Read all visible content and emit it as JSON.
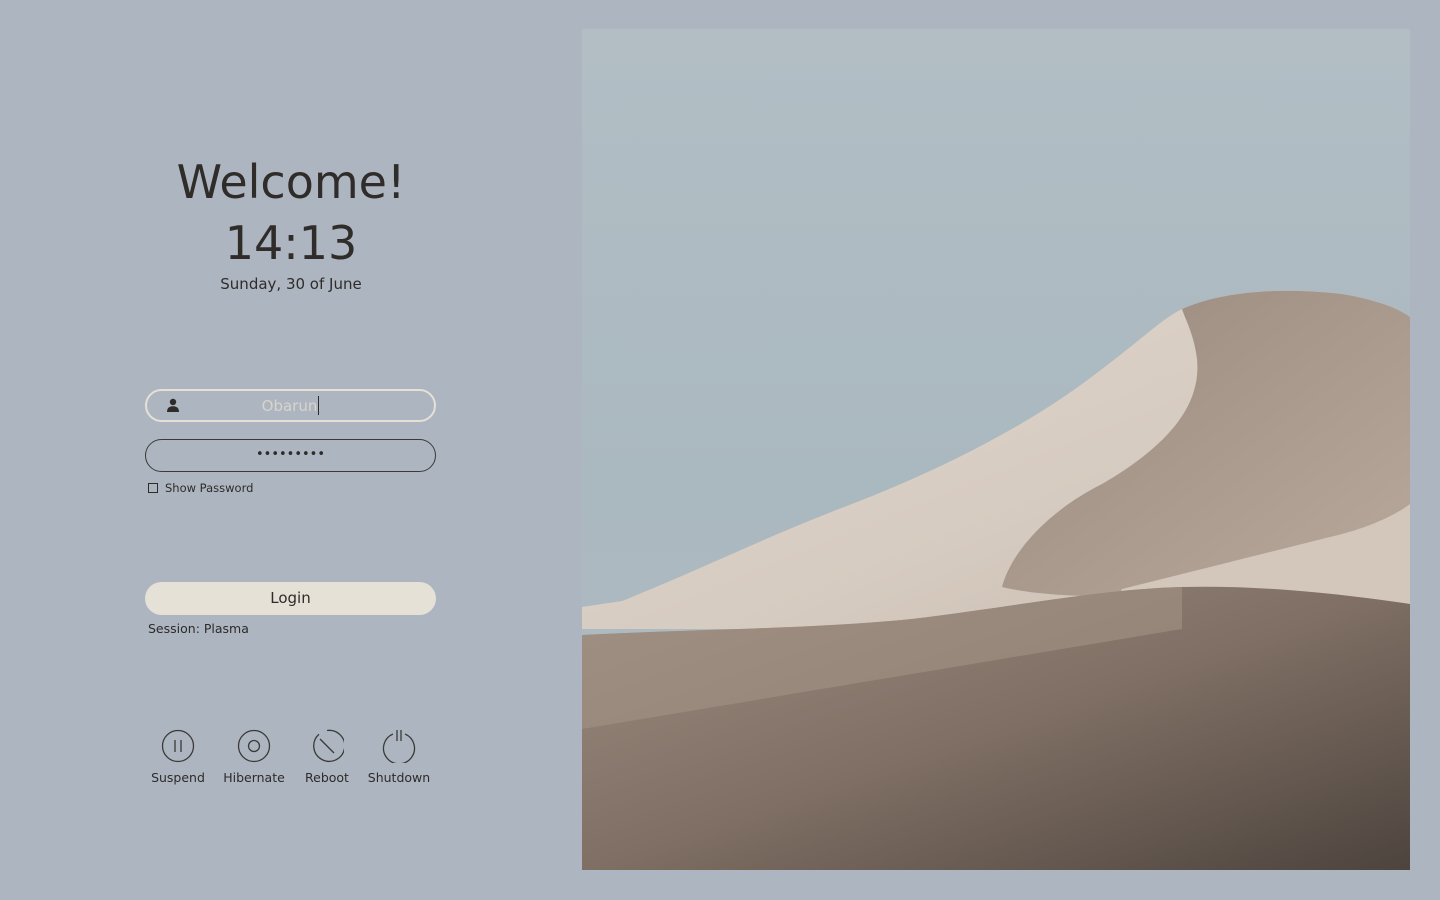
{
  "greeting": {
    "welcome": "Welcome!",
    "time": "14:13",
    "date": "Sunday, 30 of June"
  },
  "login_form": {
    "username_value": "Obarun",
    "password_masked": "•••••••••",
    "show_password_label": "Show Password",
    "login_label": "Login",
    "session_label": "Session: Plasma"
  },
  "power": {
    "suspend_label": "Suspend",
    "hibernate_label": "Hibernate",
    "reboot_label": "Reboot",
    "shutdown_label": "Shutdown"
  },
  "icons": {
    "user": "user-icon",
    "suspend": "pause-icon",
    "hibernate": "hibernate-icon",
    "reboot": "reboot-icon",
    "shutdown": "power-icon"
  },
  "colors": {
    "background": "#adb6c0",
    "accent": "#e6e1d6",
    "text": "#2e2b29"
  }
}
